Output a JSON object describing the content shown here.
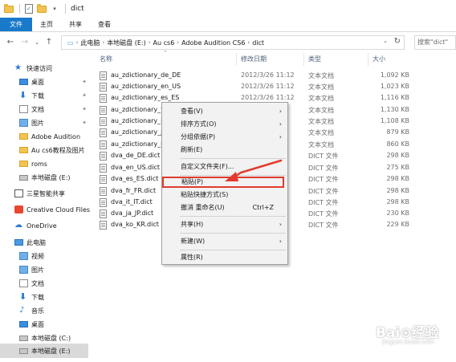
{
  "window": {
    "title": "dict"
  },
  "ribbon": {
    "tabs": [
      "文件",
      "主页",
      "共享",
      "查看"
    ]
  },
  "address": {
    "crumbs": [
      "此电脑",
      "本地磁盘 (E:)",
      "Au cs6",
      "Adobe Audition CS6",
      "dict"
    ],
    "search_placeholder": "搜索\"dict\""
  },
  "nav": {
    "items": [
      {
        "label": "快速访问",
        "icon": "star-icon"
      },
      {
        "label": "桌面",
        "icon": "desktop-icon",
        "pinned": true
      },
      {
        "label": "下载",
        "icon": "download-icon",
        "pinned": true
      },
      {
        "label": "文档",
        "icon": "document-icon",
        "pinned": true
      },
      {
        "label": "图片",
        "icon": "pictures-icon",
        "pinned": true
      },
      {
        "label": "Adobe Audition",
        "icon": "folder-icon"
      },
      {
        "label": "Au cs6教程及图片",
        "icon": "folder-icon"
      },
      {
        "label": "roms",
        "icon": "folder-icon"
      },
      {
        "label": "本地磁盘 (E:)",
        "icon": "drive-icon"
      },
      {
        "label": "三星智能共享",
        "icon": "tv-icon"
      },
      {
        "label": "Creative Cloud Files",
        "icon": "creative-cloud-icon"
      },
      {
        "label": "OneDrive",
        "icon": "onedrive-icon"
      },
      {
        "label": "此电脑",
        "icon": "computer-icon"
      },
      {
        "label": "视频",
        "icon": "video-icon"
      },
      {
        "label": "图片",
        "icon": "pictures-icon"
      },
      {
        "label": "文档",
        "icon": "document-icon"
      },
      {
        "label": "下载",
        "icon": "download-icon"
      },
      {
        "label": "音乐",
        "icon": "music-icon"
      },
      {
        "label": "桌面",
        "icon": "desktop-icon"
      },
      {
        "label": "本地磁盘 (C:)",
        "icon": "drive-icon"
      },
      {
        "label": "本地磁盘 (E:)",
        "icon": "drive-icon",
        "selected": true
      }
    ]
  },
  "columns": {
    "name": "名称",
    "date": "修改日期",
    "type": "类型",
    "size": "大小"
  },
  "files": [
    {
      "name": "au_zdictionary_de_DE",
      "date": "2012/3/26 11:12",
      "type": "文本文档",
      "size": "1,092 KB"
    },
    {
      "name": "au_zdictionary_en_US",
      "date": "2012/3/26 11:12",
      "type": "文本文档",
      "size": "1,023 KB"
    },
    {
      "name": "au_zdictionary_es_ES",
      "date": "2012/3/26 11:12",
      "type": "文本文档",
      "size": "1,116 KB"
    },
    {
      "name": "au_zdictionary_f",
      "date": "",
      "type": "文本文档",
      "size": "1,130 KB"
    },
    {
      "name": "au_zdictionary_it",
      "date": "",
      "type": "文本文档",
      "size": "1,108 KB"
    },
    {
      "name": "au_zdictionary_ja",
      "date": "",
      "type": "文本文档",
      "size": "879 KB"
    },
    {
      "name": "au_zdictionary_k",
      "date": "",
      "type": "文本文档",
      "size": "860 KB"
    },
    {
      "name": "dva_de_DE.dict",
      "date": "",
      "type": "DICT 文件",
      "size": "298 KB"
    },
    {
      "name": "dva_en_US.dict",
      "date": "",
      "type": "DICT 文件",
      "size": "275 KB"
    },
    {
      "name": "dva_es_ES.dict",
      "date": "",
      "type": "DICT 文件",
      "size": "298 KB"
    },
    {
      "name": "dva_fr_FR.dict",
      "date": "",
      "type": "DICT 文件",
      "size": "298 KB"
    },
    {
      "name": "dva_it_IT.dict",
      "date": "",
      "type": "DICT 文件",
      "size": "298 KB"
    },
    {
      "name": "dva_ja_JP.dict",
      "date": "",
      "type": "DICT 文件",
      "size": "230 KB"
    },
    {
      "name": "dva_ko_KR.dict",
      "date": "",
      "type": "DICT 文件",
      "size": "229 KB"
    }
  ],
  "context_menu": {
    "view": "查看(V)",
    "sort": "排序方式(O)",
    "group": "分组依据(P)",
    "refresh": "刷新(E)",
    "customize": "自定义文件夹(F)...",
    "paste": "粘贴(P)",
    "paste_shortcut": "粘贴快捷方式(S)",
    "undo_rename": "撤消 重命名(U)",
    "undo_accel": "Ctrl+Z",
    "share": "共享(H)",
    "new": "新建(W)",
    "properties": "属性(R)"
  },
  "colors": {
    "accent": "#1979ca",
    "highlight": "#e03b2e"
  },
  "watermark": {
    "brand": "Bai⊙经验",
    "url": "jingyan.baidu.com"
  }
}
